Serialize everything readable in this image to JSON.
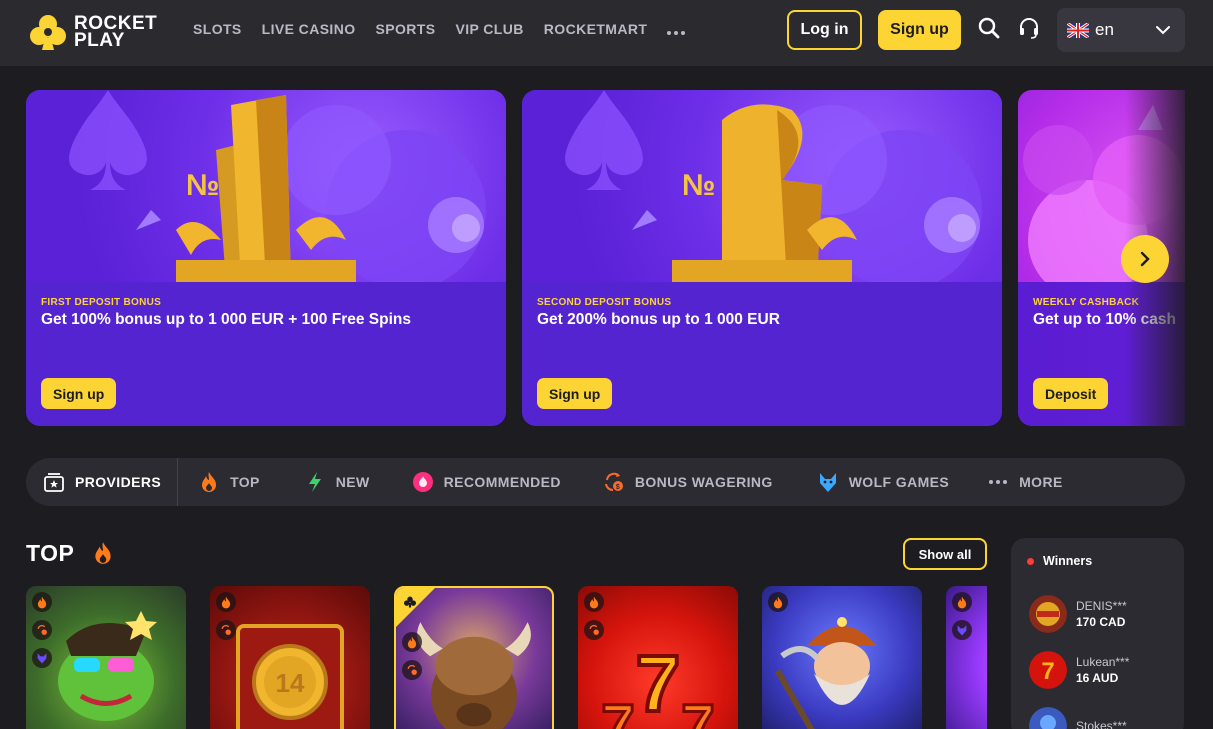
{
  "brand": {
    "line1": "ROCKET",
    "line2": "PLAY"
  },
  "nav": {
    "items": [
      "SLOTS",
      "LIVE CASINO",
      "SPORTS",
      "VIP CLUB",
      "ROCKETMART"
    ]
  },
  "auth": {
    "login_label": "Log in",
    "signup_label": "Sign up"
  },
  "language": {
    "code": "en"
  },
  "promos": [
    {
      "kicker": "FIRST DEPOSIT BONUS",
      "title": "Get 100% bonus up to 1 000 EUR + 100 Free Spins",
      "button": "Sign up"
    },
    {
      "kicker": "SECOND DEPOSIT BONUS",
      "title": "Get 200% bonus up to 1 000 EUR",
      "button": "Sign up"
    },
    {
      "kicker": "WEEKLY CASHBACK",
      "title": "Get up to 10% cash",
      "button": "Deposit"
    }
  ],
  "categories": {
    "providers": "PROVIDERS",
    "top": "TOP",
    "new": "NEW",
    "recommended": "RECOMMENDED",
    "bonus_wagering": "BONUS WAGERING",
    "wolf_games": "WOLF GAMES",
    "more": "MORE"
  },
  "top_section": {
    "title": "TOP",
    "show_all": "Show all"
  },
  "winners": {
    "title": "Winners",
    "list": [
      {
        "name": "DENIS***",
        "amount": "170 CAD"
      },
      {
        "name": "Lukean***",
        "amount": "16 AUD"
      },
      {
        "name": "Stokes***",
        "amount": ""
      }
    ]
  },
  "colors": {
    "accent": "#fcd535",
    "header_bg": "#2a2a2f",
    "page_bg": "#1d1c21",
    "promo_purple": "#5424d0"
  }
}
